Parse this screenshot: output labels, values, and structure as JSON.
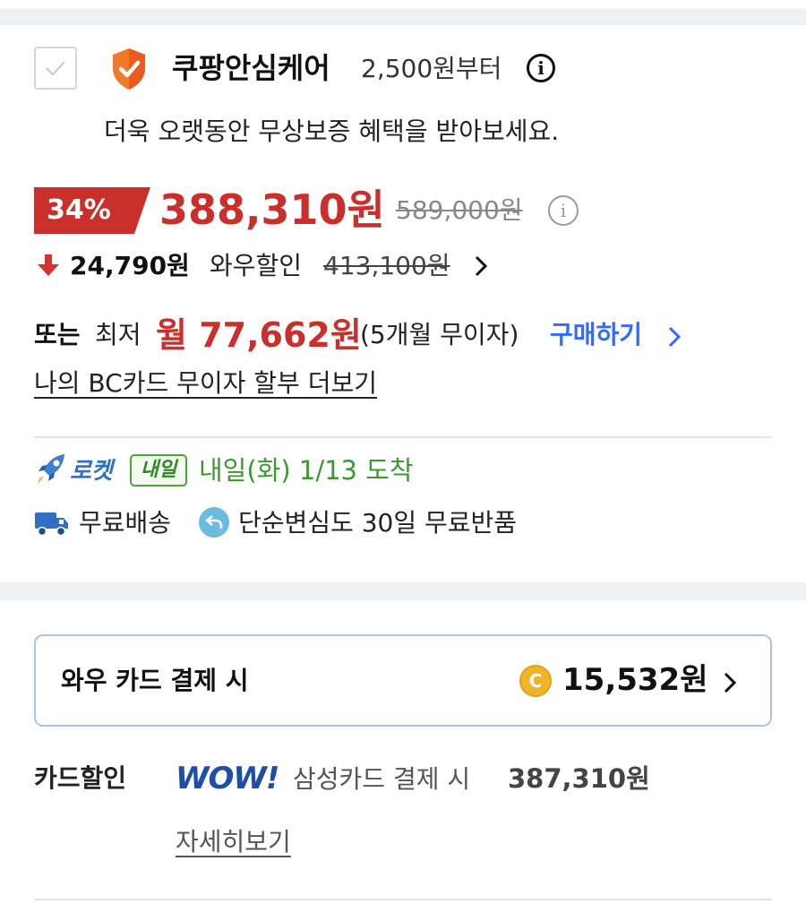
{
  "care": {
    "title": "쿠팡안심케어",
    "price": "2,500원부터",
    "info_glyph": "i",
    "description": "더욱 오랫동안 무상보증 혜택을 받아보세요."
  },
  "price": {
    "discount_badge": "34%",
    "sale_price": "388,310원",
    "original_price": "589,000원",
    "info_glyph": "i"
  },
  "wow": {
    "discount_amount": "24,790원",
    "label": "와우할인",
    "original": "413,100원"
  },
  "installment": {
    "prefix": "또는",
    "lowest": "최저",
    "monthly": "월 77,662원",
    "terms": "(5개월 무이자)",
    "buy_label": "구매하기",
    "bc_link": "나의 BC카드 무이자 할부 더보기"
  },
  "delivery": {
    "rocket_label": "로켓",
    "badge": "내일",
    "date_text": "내일(화) 1/13 도착",
    "free_shipping": "무료배송",
    "return_policy": "단순변심도 30일 무료반품"
  },
  "wow_card": {
    "label": "와우 카드 결제 시",
    "coin_glyph": "C",
    "amount": "15,532원"
  },
  "card_discount": {
    "label": "카드할인",
    "wow_logo": "WOW!",
    "text": "삼성카드 결제 시",
    "price": "387,310원",
    "detail_link": "자세히보기"
  },
  "colors": {
    "sale_red": "#c9302c",
    "link_blue": "#346aff",
    "delivery_green": "#3a9a2e",
    "wow_navy": "#1d4fa5",
    "coin_gold": "#f0b429"
  },
  "icons": [
    "checkbox-check-icon",
    "shield-check-icon",
    "info-icon",
    "down-arrow-icon",
    "chevron-right-icon",
    "rocket-icon",
    "truck-icon",
    "return-icon",
    "coin-icon"
  ]
}
